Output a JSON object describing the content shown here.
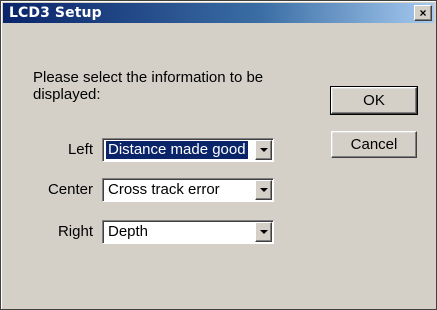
{
  "window": {
    "title": "LCD3 Setup",
    "close_glyph": "×"
  },
  "prompt": "Please select the information to be displayed:",
  "buttons": {
    "ok": "OK",
    "cancel": "Cancel"
  },
  "fields": [
    {
      "label": "Left",
      "value": "Distance made good"
    },
    {
      "label": "Center",
      "value": "Cross track error"
    },
    {
      "label": "Right",
      "value": "Depth"
    }
  ],
  "colors": {
    "titlebar_start": "#0a246a",
    "titlebar_end": "#a6caf0",
    "dialog_bg": "#d4d0c8",
    "selection": "#0a246a"
  }
}
